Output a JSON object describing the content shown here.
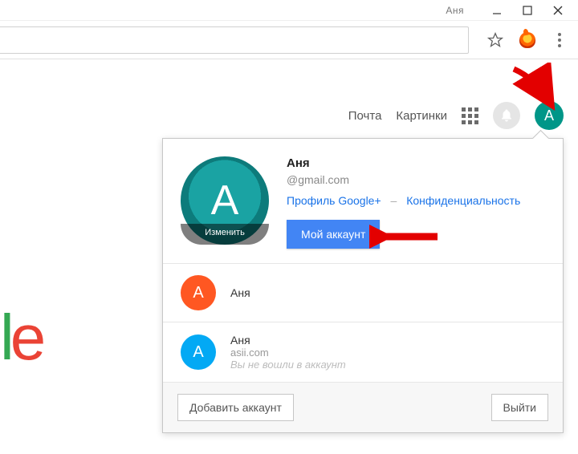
{
  "window": {
    "title": "Аня"
  },
  "googlebar": {
    "mail": "Почта",
    "images": "Картинки",
    "avatar_letter": "А"
  },
  "logo_fragment": {
    "l": "l",
    "e": "e"
  },
  "popup": {
    "name": "Аня",
    "email": "@gmail.com",
    "profile_link": "Профиль Google+",
    "privacy_link": "Конфиденциальность",
    "my_account": "Мой аккаунт",
    "change": "Изменить",
    "avatar_letter": "А"
  },
  "accounts": [
    {
      "letter": "А",
      "color": "orange",
      "name": "Аня",
      "email": "",
      "note": ""
    },
    {
      "letter": "А",
      "color": "blue",
      "name": "Аня",
      "email": "asii.com",
      "note": "Вы не вошли в аккаунт"
    }
  ],
  "footer": {
    "add": "Добавить аккаунт",
    "signout": "Выйти"
  }
}
